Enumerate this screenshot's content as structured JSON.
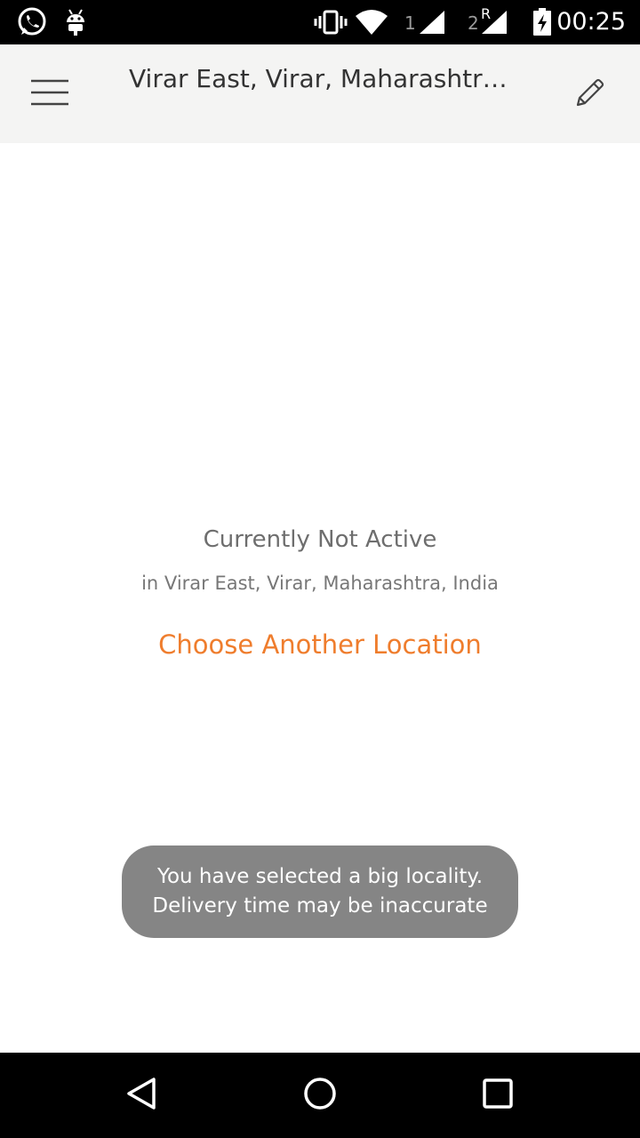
{
  "status_bar": {
    "time": "00:25",
    "sim1": "1",
    "sim2": "2",
    "sim2_roaming": "R",
    "icons": [
      "whatsapp-icon",
      "android-icon",
      "vibrate-icon",
      "wifi-icon",
      "signal-icon",
      "signal-roaming-icon",
      "battery-charging-icon"
    ]
  },
  "app_bar": {
    "title": "Virar East, Virar, Maharashtra, India",
    "menu_icon": "hamburger-menu-icon",
    "edit_icon": "pencil-icon"
  },
  "main": {
    "status_title": "Currently Not Active",
    "status_subtitle": "in Virar East, Virar, Maharashtra, India",
    "choose_location_label": "Choose Another Location"
  },
  "toast": {
    "line1": "You have selected a big locality.",
    "line2": "Delivery time may be inaccurate"
  },
  "nav_bar": {
    "icons": [
      "back-icon",
      "home-icon",
      "recents-icon"
    ]
  },
  "colors": {
    "accent": "#ef7d2d",
    "app_bar_bg": "#f4f4f3",
    "toast_bg": "#858585",
    "status_bar_bg": "#000000"
  }
}
